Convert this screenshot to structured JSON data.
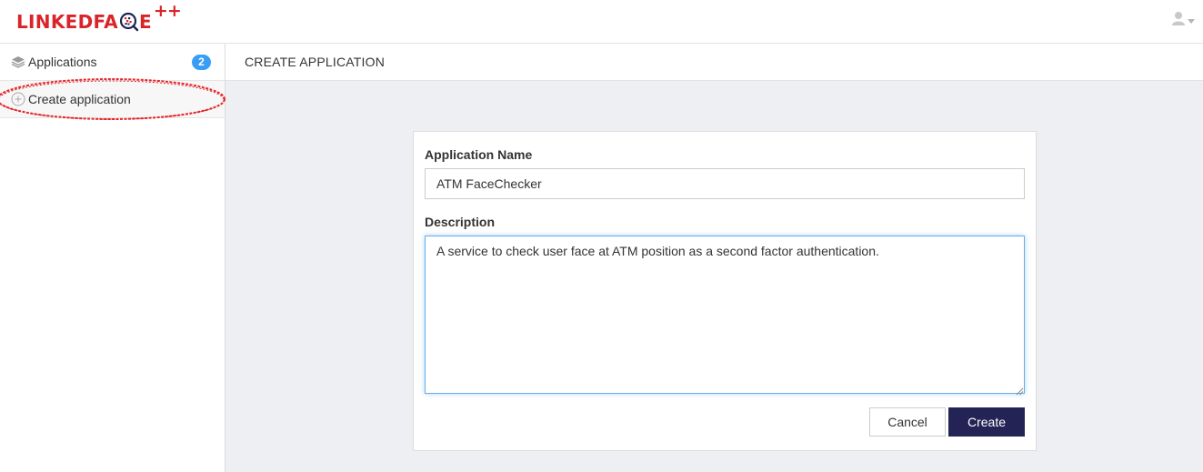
{
  "brand": {
    "name_left": "LINKEDFA",
    "name_right": "E",
    "superscript": "++",
    "brand_color": "#d9252a"
  },
  "header": {
    "user_icon": "user-avatar-icon",
    "dropdown_icon": "caret-down-icon"
  },
  "sidebar": {
    "items": [
      {
        "label": "Applications",
        "icon": "layers-icon",
        "badge": "2"
      },
      {
        "label": "Create application",
        "icon": "plus-circle-icon"
      }
    ],
    "badge_color": "#3a9df5",
    "annotation_color": "#e3262b"
  },
  "main": {
    "title": "CREATE APPLICATION"
  },
  "form": {
    "name_label": "Application Name",
    "name_value": "ATM FaceChecker",
    "description_label": "Description",
    "description_value": "A service to check user face at ATM position as a second factor authentication.",
    "cancel_label": "Cancel",
    "create_label": "Create",
    "primary_color": "#232455"
  }
}
